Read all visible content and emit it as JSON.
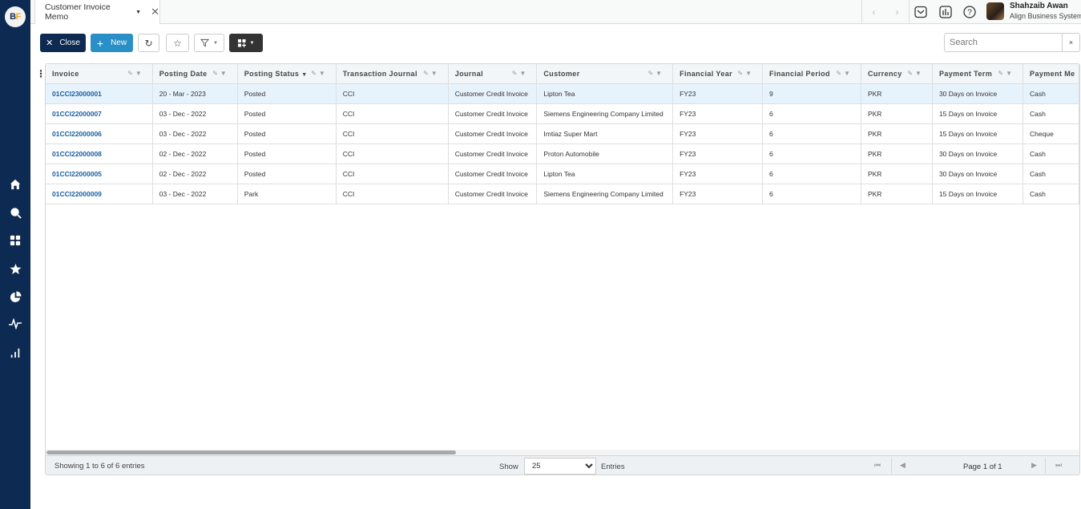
{
  "app": {
    "logo_text_b": "B",
    "logo_text_f": "F",
    "tab_title": "Customer Invoice Memo",
    "user_name": "Shahzaib Awan",
    "user_org": "Align Business System"
  },
  "sidebar": {
    "items": [
      {
        "icon": "home-icon"
      },
      {
        "icon": "search-icon"
      },
      {
        "icon": "dashboard-icon"
      },
      {
        "icon": "star-icon"
      },
      {
        "icon": "pie-chart-icon"
      },
      {
        "icon": "activity-icon"
      },
      {
        "icon": "bar-chart-icon"
      }
    ]
  },
  "toolbar": {
    "close_label": "Close",
    "new_label": "New",
    "search_placeholder": "Search",
    "search_clear": "×"
  },
  "table": {
    "columns": [
      "Invoice",
      "Posting Date",
      "Posting Status",
      "Transaction Journal",
      "Journal",
      "Customer",
      "Financial Year",
      "Financial Period",
      "Currency",
      "Payment Term",
      "Payment Me"
    ],
    "rows": [
      [
        "01CCI23000001",
        "20 - Mar - 2023",
        "Posted",
        "CCI",
        "Customer Credit Invoice",
        "Lipton Tea",
        "FY23",
        "9",
        "PKR",
        "30 Days on Invoice",
        "Cash"
      ],
      [
        "01CCI22000007",
        "03 - Dec - 2022",
        "Posted",
        "CCI",
        "Customer Credit Invoice",
        "Siemens Engineering Company Limited",
        "FY23",
        "6",
        "PKR",
        "15 Days on Invoice",
        "Cash"
      ],
      [
        "01CCI22000006",
        "03 - Dec - 2022",
        "Posted",
        "CCI",
        "Customer Credit Invoice",
        "Imtiaz Super Mart",
        "FY23",
        "6",
        "PKR",
        "15 Days on Invoice",
        "Cheque"
      ],
      [
        "01CCI22000008",
        "02 - Dec - 2022",
        "Posted",
        "CCI",
        "Customer Credit Invoice",
        "Proton Automobile",
        "FY23",
        "6",
        "PKR",
        "30 Days on Invoice",
        "Cash"
      ],
      [
        "01CCI22000005",
        "02 - Dec - 2022",
        "Posted",
        "CCI",
        "Customer Credit Invoice",
        "Lipton Tea",
        "FY23",
        "6",
        "PKR",
        "30 Days on Invoice",
        "Cash"
      ],
      [
        "01CCI22000009",
        "03 - Dec - 2022",
        "Park",
        "CCI",
        "Customer Credit Invoice",
        "Siemens Engineering Company Limited",
        "FY23",
        "6",
        "PKR",
        "15 Days on Invoice",
        "Cash"
      ]
    ],
    "selected_row": 0
  },
  "footer": {
    "info": "Showing 1 to 6 of 6 entries",
    "show_label": "Show",
    "page_size": "25",
    "entries_label": "Entries",
    "page_info": "Page 1 of 1"
  },
  "colors": {
    "sidebar": "#0d2a52",
    "primary": "#2a8fc7",
    "link": "#1a5fa0",
    "selected_row": "#e7f3fc"
  }
}
